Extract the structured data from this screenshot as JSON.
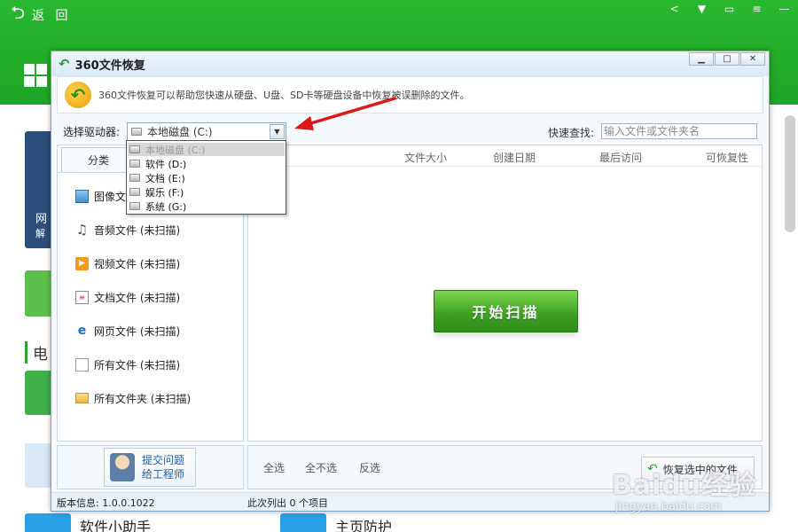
{
  "background": {
    "back_label": "返 回",
    "back_arrow": "⮌",
    "controls": [
      "share-icon",
      "shirt-icon",
      "chat-icon",
      "menu-icon",
      "minimize-icon"
    ],
    "weather_text": "网",
    "weather_sub": "解",
    "section_char": "电",
    "bottom_left_label": "软件小助手",
    "bottom_right_label": "主页防护"
  },
  "dialog": {
    "title": "360文件恢复",
    "controls": {
      "minimize": "▁",
      "maximize": "□",
      "close": "✕"
    },
    "banner": "360文件恢复可以帮助您快速从硬盘、U盘、SD卡等硬盘设备中恢复被误删除的文件。"
  },
  "toolbar": {
    "drive_label": "选择驱动器:",
    "drive_selected": "本地磁盘 (C:)",
    "search_label": "快速查找:",
    "search_placeholder": "输入文件或文件夹名"
  },
  "drive_options": [
    {
      "label": "本地磁盘 (C:)",
      "selected": true
    },
    {
      "label": "软件 (D:)",
      "selected": false
    },
    {
      "label": "文档 (E:)",
      "selected": false
    },
    {
      "label": "娱乐 (F:)",
      "selected": false
    },
    {
      "label": "系统 (G:)",
      "selected": false
    }
  ],
  "categories": {
    "tab_label": "分类",
    "items": [
      {
        "label": "图像文件 (未扫描)",
        "icon": "image-icon"
      },
      {
        "label": "音频文件 (未扫描)",
        "icon": "audio-icon"
      },
      {
        "label": "视频文件 (未扫描)",
        "icon": "video-icon"
      },
      {
        "label": "文档文件 (未扫描)",
        "icon": "document-icon"
      },
      {
        "label": "网页文件 (未扫描)",
        "icon": "web-icon"
      },
      {
        "label": "所有文件 (未扫描)",
        "icon": "file-icon"
      },
      {
        "label": "所有文件夹 (未扫描)",
        "icon": "folder-icon"
      }
    ]
  },
  "table": {
    "columns": [
      "件",
      "文件大小",
      "创建日期",
      "最后访问",
      "可恢复性"
    ]
  },
  "scan_button": "开始扫描",
  "selection": {
    "all": "全选",
    "none": "全不选",
    "invert": "反选"
  },
  "recover_button": "恢复选中的文件",
  "ask": {
    "line1": "提交问题",
    "line2": "给工程师"
  },
  "status": {
    "version": "版本信息: 1.0.0.1022",
    "count": "此次列出 0 个项目"
  },
  "watermark": {
    "logo": "Baidu经验",
    "url": "jingyan.baidu.com"
  },
  "colors": {
    "app_green": "#28b82f",
    "scan_green": "#3ea224",
    "annotation_red": "#e01515"
  }
}
